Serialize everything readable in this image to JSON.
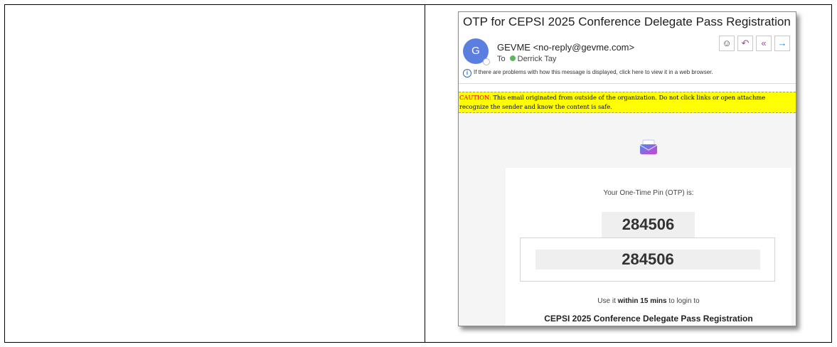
{
  "email": {
    "subject": "OTP for CEPSI 2025 Conference Delegate Pass Registration",
    "avatar_initial": "G",
    "sender": "GEVME <no-reply@gevme.com>",
    "to_label": "To",
    "recipient": "Derrick Tay",
    "info_text": "If there are problems with how this message is displayed, click here to view it in a web browser.",
    "caution_label": "CAUTION:",
    "caution_text_line1": " This email originated from outside of the organization. Do not click links or open attachme",
    "caution_text_line2": "recognize the sender and know the content is safe.",
    "actions": {
      "emoji_icon": "smiley-icon",
      "reply_icon": "reply-icon",
      "reply_all_icon": "reply-all-icon",
      "forward_icon": "forward-icon"
    }
  },
  "body": {
    "otp_label": "Your One-Time Pin (OTP) is:",
    "otp_code": "284506",
    "otp_code_repeat": "284506",
    "use_prefix": "Use it ",
    "use_bold": "within 15 mins",
    "use_suffix": " to login to",
    "event_title": "CEPSI 2025 Conference Delegate Pass Registration"
  },
  "colors": {
    "caution_bg": "#ffff00",
    "caution_label": "#e00000",
    "avatar": "#5b7fe0",
    "presence": "#5cb85c",
    "reply_accent": "#a04a9e",
    "forward_accent": "#2b7cd3"
  }
}
